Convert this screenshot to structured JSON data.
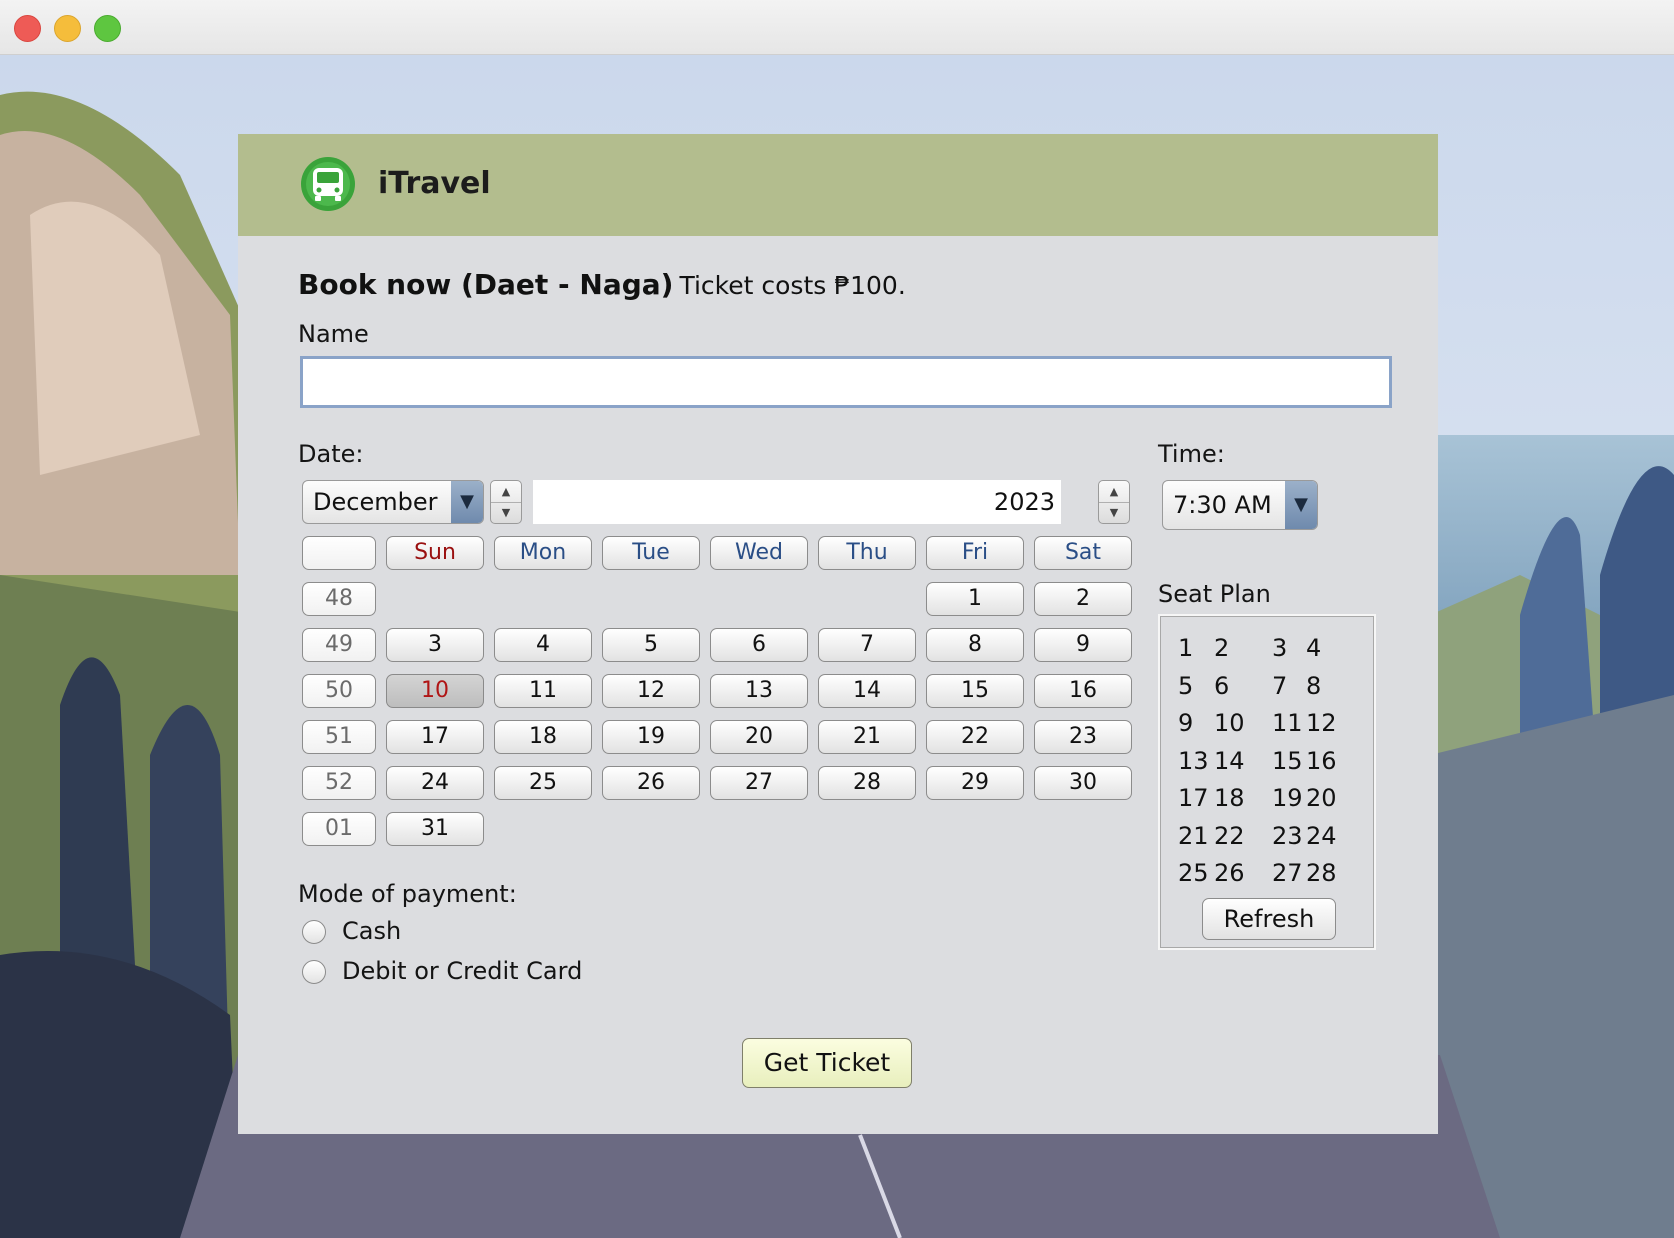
{
  "window": {
    "close": "close",
    "minimize": "minimize",
    "zoom": "zoom"
  },
  "app": {
    "title": "iTravel",
    "logo_icon": "bus-icon"
  },
  "form": {
    "heading": "Book now (Daet - Naga)",
    "subheading": "Ticket costs ₱100.",
    "name_label": "Name",
    "name_value": "",
    "date_label": "Date:",
    "month": "December",
    "year": "2023",
    "time_label": "Time:",
    "time": "7:30 AM",
    "payment_label": "Mode of payment:",
    "payment_options": [
      "Cash",
      "Debit or Credit Card"
    ],
    "seat_plan_label": "Seat Plan",
    "refresh_label": "Refresh",
    "get_ticket_label": "Get Ticket"
  },
  "calendar": {
    "day_names": [
      "Sun",
      "Mon",
      "Tue",
      "Wed",
      "Thu",
      "Fri",
      "Sat"
    ],
    "selected_day": "10",
    "weeks": [
      {
        "week": "48",
        "days": [
          "",
          "",
          "",
          "",
          "",
          "1",
          "2"
        ]
      },
      {
        "week": "49",
        "days": [
          "3",
          "4",
          "5",
          "6",
          "7",
          "8",
          "9"
        ]
      },
      {
        "week": "50",
        "days": [
          "10",
          "11",
          "12",
          "13",
          "14",
          "15",
          "16"
        ]
      },
      {
        "week": "51",
        "days": [
          "17",
          "18",
          "19",
          "20",
          "21",
          "22",
          "23"
        ]
      },
      {
        "week": "52",
        "days": [
          "24",
          "25",
          "26",
          "27",
          "28",
          "29",
          "30"
        ]
      },
      {
        "week": "01",
        "days": [
          "31",
          "",
          "",
          "",
          "",
          "",
          ""
        ]
      }
    ]
  },
  "seats": [
    [
      "1",
      "2",
      "3",
      "4"
    ],
    [
      "5",
      "6",
      "7",
      "8"
    ],
    [
      "9",
      "10",
      "11",
      "12"
    ],
    [
      "13",
      "14",
      "15",
      "16"
    ],
    [
      "17",
      "18",
      "19",
      "20"
    ],
    [
      "21",
      "22",
      "23",
      "24"
    ],
    [
      "25",
      "26",
      "27",
      "28"
    ]
  ],
  "colors": {
    "header": "#b3bd8e",
    "panel": "#dcdde0",
    "logo": "#3aa33a"
  }
}
